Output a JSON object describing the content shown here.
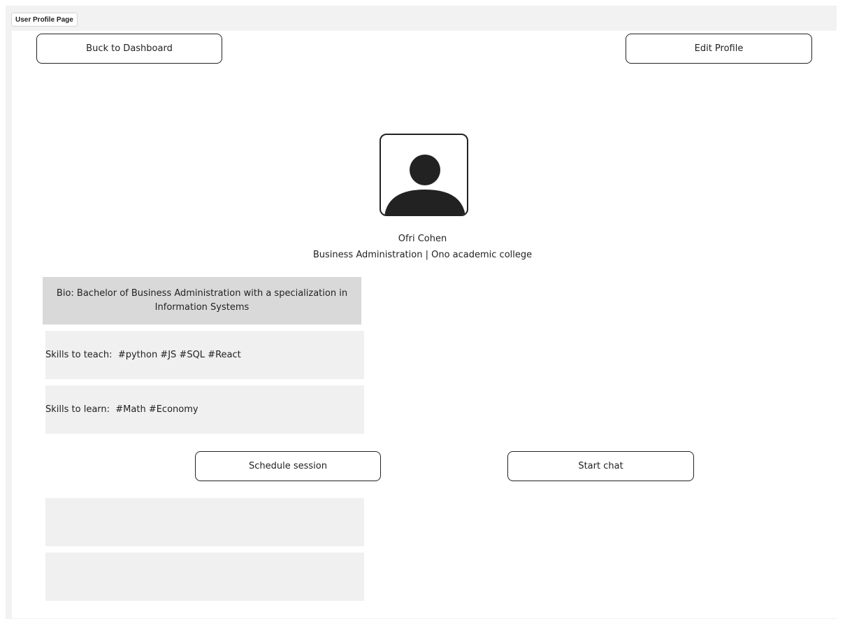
{
  "page_label": "User Profile Page",
  "header": {
    "back_label": "Buck to Dashboard",
    "edit_label": "Edit Profile"
  },
  "profile": {
    "avatar_icon": "user-avatar-icon",
    "name": "Ofri Cohen",
    "subtitle": "Business Administration | Ono academic college"
  },
  "bio": {
    "text": "Bio: Bachelor of Business Administration with a specialization in Information Systems"
  },
  "skills": {
    "teach_label": "Skills to teach:",
    "teach_tags": "#python #JS #SQL #React",
    "learn_label": "Skills to learn:",
    "learn_tags": "#Math #Economy"
  },
  "actions": {
    "schedule_label": "Schedule session",
    "chat_label": "Start chat"
  },
  "colors": {
    "frame_bg": "#f2f2f2",
    "bio_bg": "#d9d9d9",
    "panel_bg": "#f0f0f0",
    "stroke": "#222222"
  }
}
